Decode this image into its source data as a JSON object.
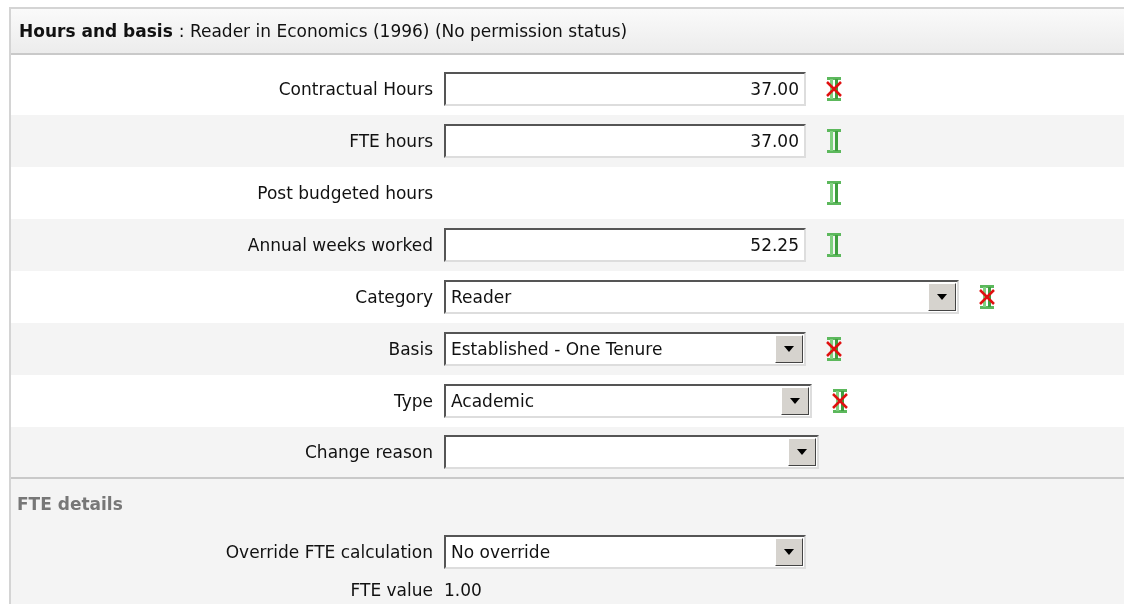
{
  "header": {
    "title": "Hours and basis",
    "subtitle": ": Reader in Economics (1996) (No permission status)"
  },
  "rows": [
    {
      "kind": "text",
      "label": "Contractual Hours",
      "value": "37.00",
      "valid": false
    },
    {
      "kind": "text",
      "label": "FTE hours",
      "value": "37.00",
      "valid": true
    },
    {
      "kind": "none",
      "label": "Post budgeted hours",
      "valid": true
    },
    {
      "kind": "text",
      "label": "Annual weeks worked",
      "value": "52.25",
      "valid": true
    },
    {
      "kind": "select",
      "label": "Category",
      "value": "Reader",
      "valid": false
    },
    {
      "kind": "select",
      "label": "Basis",
      "value": "Established - One Tenure",
      "valid": false
    },
    {
      "kind": "select",
      "label": "Type",
      "value": "Academic",
      "valid": false
    },
    {
      "kind": "select",
      "label": "Change reason"
    }
  ],
  "fte_details": {
    "title": "FTE details",
    "rows": [
      {
        "kind": "select",
        "label": "Override FTE calculation",
        "value": "No override"
      },
      {
        "kind": "plain",
        "label": "FTE value",
        "value": "1.00"
      }
    ]
  }
}
